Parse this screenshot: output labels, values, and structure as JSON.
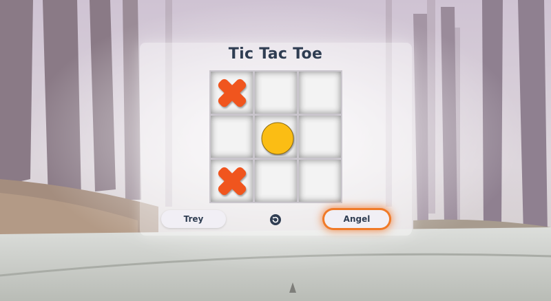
{
  "game": {
    "title": "Tic Tac Toe",
    "board": [
      "X",
      "",
      "",
      "",
      "O",
      "",
      "X",
      "",
      ""
    ],
    "players": {
      "left": "Trey",
      "right": "Angel"
    },
    "active_player": "right",
    "reset_icon": "reset-icon"
  },
  "colors": {
    "x_mark": "#f0551e",
    "o_mark": "#fbbd14",
    "title": "#2f3d52",
    "active_glow": "#f07a28"
  }
}
